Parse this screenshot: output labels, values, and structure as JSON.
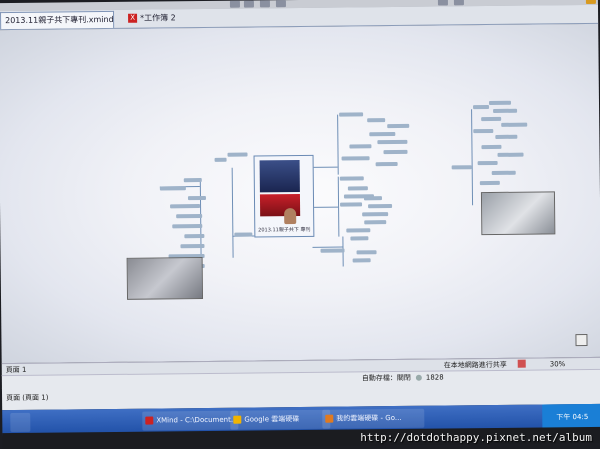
{
  "tabs": [
    {
      "label": "2013.11親子共下專刊.xmind",
      "active": true
    },
    {
      "label": "*工作簿 2",
      "active": false
    }
  ],
  "central_topic": {
    "caption": "2013.11親子共下 專刊"
  },
  "status": {
    "page_label": "頁面 1",
    "autosave": "自動存檔：關閉",
    "user": "1828",
    "share": "在本地網路進行共享",
    "zoom": "30%",
    "page_footer": "頁面 (頁面 1)"
  },
  "taskbar": {
    "items": [
      {
        "label": "XMind - C:\\Document..."
      },
      {
        "label": "Google 雲端硬碟"
      },
      {
        "label": "我的雲端硬碟 - Go..."
      }
    ],
    "tray_time": "下午 04:5"
  },
  "watermark": "http://dotdothappy.pixnet.net/album",
  "colors": {
    "accent": "#1f4fa6",
    "node_line": "#6f8fb6"
  }
}
